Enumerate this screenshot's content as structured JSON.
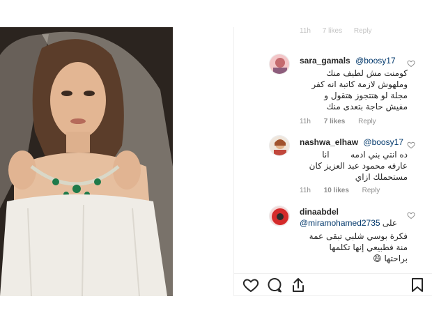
{
  "top_meta": {
    "time": "11h",
    "likes": "7 likes",
    "reply": "Reply"
  },
  "comments": [
    {
      "username": "sara_gamals",
      "mention": "@boosy17",
      "lines": [
        "كومنت مش لطيف منك",
        "وملهوش لازمة كاتبة انه كفر",
        "مجلة لو هتتجوز هتقول و",
        "مفيش حاجة بتعدى منك"
      ],
      "time": "11h",
      "likes": "7 likes",
      "reply": "Reply"
    },
    {
      "username": "nashwa_elhaw",
      "mention": "@boosy17",
      "lines": [
        "ده انتي بني ادمه",
        "انا",
        "عارفه محمود عبد العزيز كان",
        "مستحملك ازاي"
      ],
      "time": "11h",
      "likes": "10 likes",
      "reply": "Reply"
    },
    {
      "username": "dinaabdel",
      "mention": "@miramohamed2735",
      "prefix": "على",
      "lines": [
        "فكرة بوسي شلبي تبقى عمة",
        "منة فطبيعي إنها تكلمها",
        "براحتها 😄"
      ]
    }
  ],
  "icons": {
    "like": "heart-icon",
    "comment": "comment-icon",
    "share": "share-icon",
    "save": "bookmark-icon"
  }
}
